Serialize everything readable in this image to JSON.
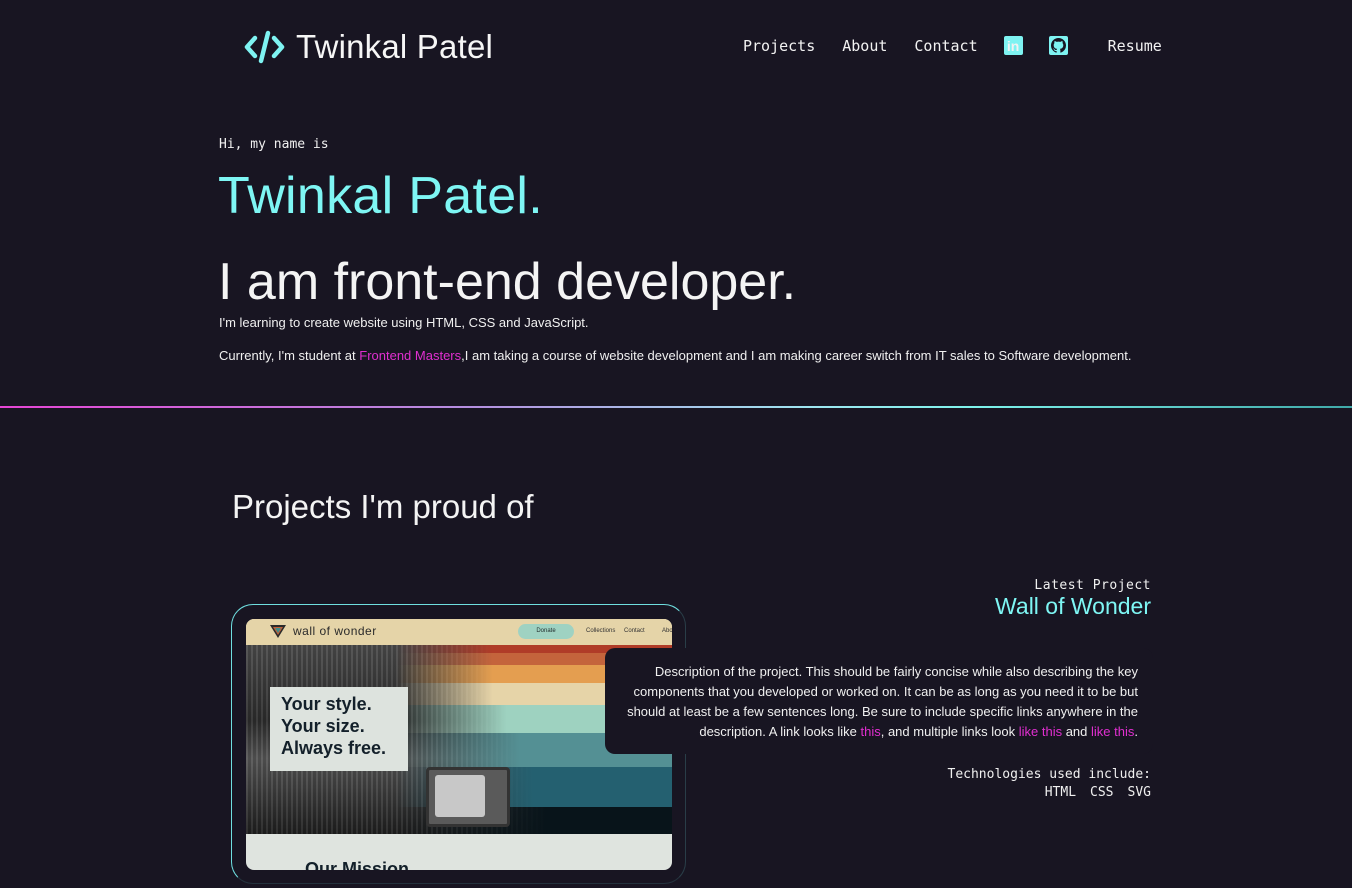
{
  "header": {
    "logo_icon": "code-brackets-icon",
    "logo_text": "Twinkal Patel",
    "nav": {
      "projects": "Projects",
      "about": "About",
      "contact": "Contact",
      "linkedin_icon": "linkedin-icon",
      "linkedin_glyph": "in",
      "github_icon": "github-icon",
      "resume": "Resume"
    }
  },
  "intro": {
    "greeting": "Hi, my name is",
    "name": "Twinkal Patel.",
    "role": "I am front-end developer.",
    "para1": "I'm learning to create website using HTML, CSS and JavaScript.",
    "para2_prefix": "Currently, I'm student at ",
    "para2_link": "Frontend Masters",
    "para2_suffix": ",I am taking a course of website development and I am making career switch from IT sales to Software development."
  },
  "projects": {
    "section_title": "Projects I'm proud of",
    "items": [
      {
        "label": "Latest Project",
        "title": "Wall of Wonder",
        "screenshot": {
          "brand": "wall of wonder",
          "donate": "Donate",
          "links": [
            "Collections",
            "Contact",
            "Abo"
          ],
          "hero_text": [
            "Your style.",
            "Your size.",
            "Always free."
          ],
          "mission": "Our Mission"
        },
        "description": {
          "text1": "Description of the project. This should be fairly concise while also describing the key components that you developed or worked on. It can be as long as you need it to be but should at least be a few sentences long. Be sure to include specific links anywhere in the description. A link looks like ",
          "link1": "this",
          "text2": ", and multiple links look ",
          "link2": "like this",
          "text3": " and ",
          "link3": "like this",
          "text4": "."
        },
        "tech_label": "Technologies used include:",
        "tech": [
          "HTML",
          "CSS",
          "SVG"
        ]
      }
    ]
  },
  "colors": {
    "background": "#181522",
    "accent_cyan": "#7ef6f4",
    "accent_pink": "#e02fd0"
  }
}
